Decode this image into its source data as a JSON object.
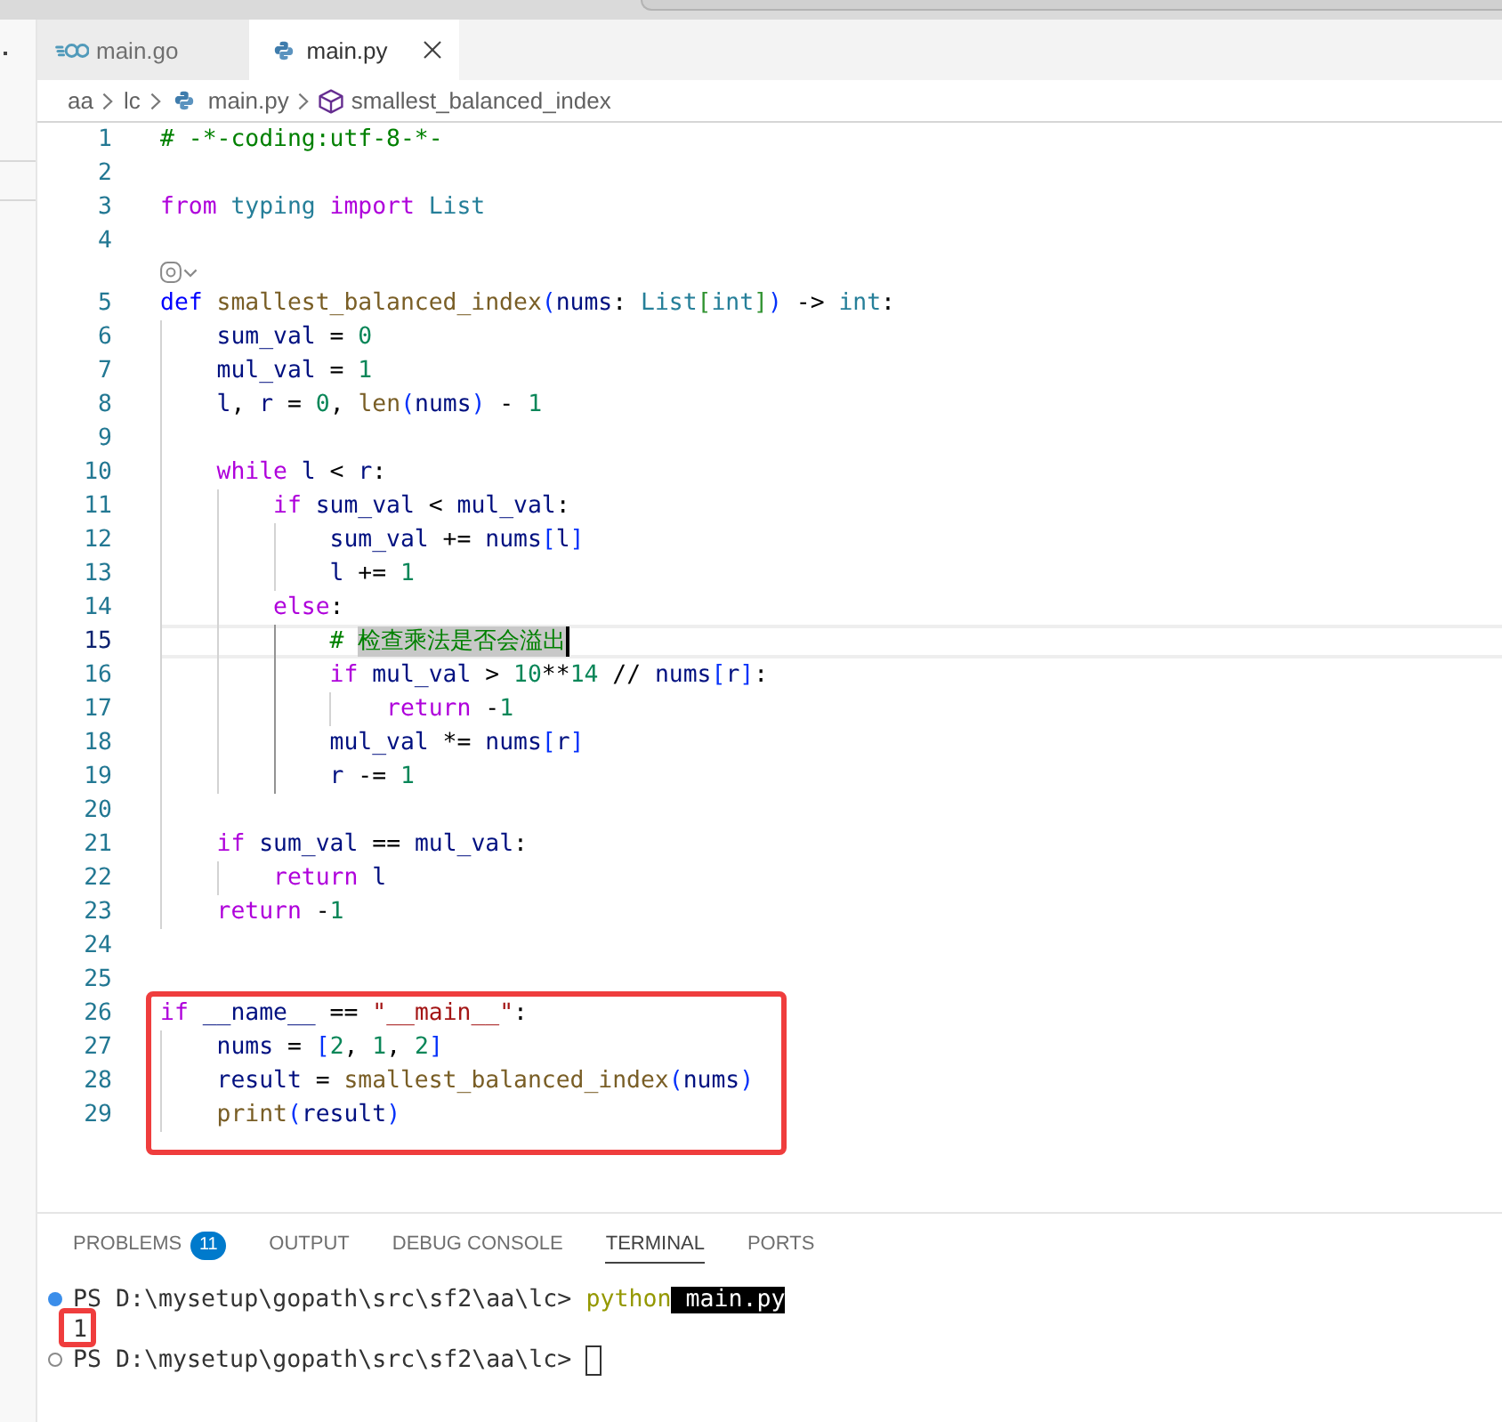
{
  "editor_tabs": [
    {
      "label": "main.go",
      "kind": "go",
      "selected": false
    },
    {
      "label": "main.py",
      "kind": "python",
      "selected": true
    }
  ],
  "breadcrumb": [
    {
      "label": "aa",
      "kind": "folder"
    },
    {
      "label": "lc",
      "kind": "folder"
    },
    {
      "label": "main.py",
      "kind": "python"
    },
    {
      "label": "smallest_balanced_index",
      "kind": "function"
    }
  ],
  "editor": {
    "lines": [
      {
        "kind": "code",
        "number": "1",
        "current": false,
        "boxed": false,
        "tokens": [
          {
            "text": "# -*-coding:utf-8-*-",
            "kind": "comment"
          }
        ]
      },
      {
        "kind": "code",
        "number": "2",
        "current": false,
        "boxed": false
      },
      {
        "kind": "code",
        "number": "3",
        "current": false,
        "boxed": false,
        "tokens": [
          {
            "text": "from",
            "kind": "keyword"
          },
          {
            "text": " typing",
            "kind": "type"
          },
          {
            "text": " import",
            "kind": "keyword"
          },
          {
            "text": " List",
            "kind": "type"
          }
        ]
      },
      {
        "kind": "code",
        "number": "4",
        "current": false,
        "boxed": false
      },
      {
        "kind": "codelens"
      },
      {
        "kind": "code",
        "number": "5",
        "current": false,
        "boxed": false,
        "tokens": [
          {
            "text": "def",
            "kind": "storage"
          },
          {
            "text": " smallest_balanced_index",
            "kind": "function"
          },
          {
            "text": "(",
            "kind": "bracket"
          },
          {
            "text": "nums",
            "kind": "variable"
          },
          {
            "text": ": ",
            "kind": "plain"
          },
          {
            "text": "List",
            "kind": "type"
          },
          {
            "text": "[",
            "kind": "subbracket"
          },
          {
            "text": "int",
            "kind": "type"
          },
          {
            "text": "]",
            "kind": "subbracket"
          },
          {
            "text": ")",
            "kind": "bracket"
          },
          {
            "text": " -> ",
            "kind": "plain"
          },
          {
            "text": "int",
            "kind": "type"
          },
          {
            "text": ":",
            "kind": "plain"
          }
        ]
      },
      {
        "kind": "code",
        "number": "6",
        "current": false,
        "boxed": false,
        "tokens": [
          {
            "text": "    sum_val",
            "kind": "variable"
          },
          {
            "text": " = ",
            "kind": "plain"
          },
          {
            "text": "0",
            "kind": "number"
          }
        ]
      },
      {
        "kind": "code",
        "number": "7",
        "current": false,
        "boxed": false,
        "tokens": [
          {
            "text": "    mul_val",
            "kind": "variable"
          },
          {
            "text": " = ",
            "kind": "plain"
          },
          {
            "text": "1",
            "kind": "number"
          }
        ]
      },
      {
        "kind": "code",
        "number": "8",
        "current": false,
        "boxed": false,
        "tokens": [
          {
            "text": "    l",
            "kind": "variable"
          },
          {
            "text": ", ",
            "kind": "plain"
          },
          {
            "text": "r",
            "kind": "variable"
          },
          {
            "text": " = ",
            "kind": "plain"
          },
          {
            "text": "0",
            "kind": "number"
          },
          {
            "text": ", ",
            "kind": "plain"
          },
          {
            "text": "len",
            "kind": "function"
          },
          {
            "text": "(",
            "kind": "bracket"
          },
          {
            "text": "nums",
            "kind": "variable"
          },
          {
            "text": ")",
            "kind": "bracket"
          },
          {
            "text": " - ",
            "kind": "plain"
          },
          {
            "text": "1",
            "kind": "number"
          }
        ]
      },
      {
        "kind": "code",
        "number": "9",
        "current": false,
        "boxed": false
      },
      {
        "kind": "code",
        "number": "10",
        "current": false,
        "boxed": false,
        "tokens": [
          {
            "text": "    while",
            "kind": "keyword"
          },
          {
            "text": " l",
            "kind": "variable"
          },
          {
            "text": " < ",
            "kind": "plain"
          },
          {
            "text": "r",
            "kind": "variable"
          },
          {
            "text": ":",
            "kind": "plain"
          }
        ]
      },
      {
        "kind": "code",
        "number": "11",
        "current": false,
        "boxed": false,
        "tokens": [
          {
            "text": "        if",
            "kind": "keyword"
          },
          {
            "text": " sum_val",
            "kind": "variable"
          },
          {
            "text": " < ",
            "kind": "plain"
          },
          {
            "text": "mul_val",
            "kind": "variable"
          },
          {
            "text": ":",
            "kind": "plain"
          }
        ]
      },
      {
        "kind": "code",
        "number": "12",
        "current": false,
        "boxed": false,
        "tokens": [
          {
            "text": "            sum_val",
            "kind": "variable"
          },
          {
            "text": " += ",
            "kind": "plain"
          },
          {
            "text": "nums",
            "kind": "variable"
          },
          {
            "text": "[",
            "kind": "bracket"
          },
          {
            "text": "l",
            "kind": "variable"
          },
          {
            "text": "]",
            "kind": "bracket"
          }
        ]
      },
      {
        "kind": "code",
        "number": "13",
        "current": false,
        "boxed": false,
        "tokens": [
          {
            "text": "            l",
            "kind": "variable"
          },
          {
            "text": " += ",
            "kind": "plain"
          },
          {
            "text": "1",
            "kind": "number"
          }
        ]
      },
      {
        "kind": "code",
        "number": "14",
        "current": false,
        "boxed": false,
        "tokens": [
          {
            "text": "        else",
            "kind": "keyword"
          },
          {
            "text": ":",
            "kind": "plain"
          }
        ]
      },
      {
        "kind": "code",
        "number": "15",
        "current": true,
        "boxed": false,
        "tokens": [
          {
            "text": "            # ",
            "kind": "comment",
            "selected": false
          },
          {
            "text": "检查乘法是否会溢出",
            "kind": "comment",
            "selected": true
          }
        ]
      },
      {
        "kind": "code",
        "number": "16",
        "current": false,
        "boxed": false,
        "tokens": [
          {
            "text": "            if",
            "kind": "keyword"
          },
          {
            "text": " mul_val",
            "kind": "variable"
          },
          {
            "text": " > ",
            "kind": "plain"
          },
          {
            "text": "10",
            "kind": "number"
          },
          {
            "text": "**",
            "kind": "plain"
          },
          {
            "text": "14",
            "kind": "number"
          },
          {
            "text": " // ",
            "kind": "plain"
          },
          {
            "text": "nums",
            "kind": "variable"
          },
          {
            "text": "[",
            "kind": "bracket"
          },
          {
            "text": "r",
            "kind": "variable"
          },
          {
            "text": "]",
            "kind": "bracket"
          },
          {
            "text": ":",
            "kind": "plain"
          }
        ]
      },
      {
        "kind": "code",
        "number": "17",
        "current": false,
        "boxed": false,
        "tokens": [
          {
            "text": "                return",
            "kind": "keyword"
          },
          {
            "text": " -",
            "kind": "plain"
          },
          {
            "text": "1",
            "kind": "number"
          }
        ]
      },
      {
        "kind": "code",
        "number": "18",
        "current": false,
        "boxed": false,
        "tokens": [
          {
            "text": "            mul_val",
            "kind": "variable"
          },
          {
            "text": " *= ",
            "kind": "plain"
          },
          {
            "text": "nums",
            "kind": "variable"
          },
          {
            "text": "[",
            "kind": "bracket"
          },
          {
            "text": "r",
            "kind": "variable"
          },
          {
            "text": "]",
            "kind": "bracket"
          }
        ]
      },
      {
        "kind": "code",
        "number": "19",
        "current": false,
        "boxed": false,
        "tokens": [
          {
            "text": "            r",
            "kind": "variable"
          },
          {
            "text": " -= ",
            "kind": "plain"
          },
          {
            "text": "1",
            "kind": "number"
          }
        ]
      },
      {
        "kind": "code",
        "number": "20",
        "current": false,
        "boxed": false
      },
      {
        "kind": "code",
        "number": "21",
        "current": false,
        "boxed": false,
        "tokens": [
          {
            "text": "    if",
            "kind": "keyword"
          },
          {
            "text": " sum_val",
            "kind": "variable"
          },
          {
            "text": " == ",
            "kind": "plain"
          },
          {
            "text": "mul_val",
            "kind": "variable"
          },
          {
            "text": ":",
            "kind": "plain"
          }
        ]
      },
      {
        "kind": "code",
        "number": "22",
        "current": false,
        "boxed": false,
        "tokens": [
          {
            "text": "        return",
            "kind": "keyword"
          },
          {
            "text": " l",
            "kind": "variable"
          }
        ]
      },
      {
        "kind": "code",
        "number": "23",
        "current": false,
        "boxed": false,
        "tokens": [
          {
            "text": "    return",
            "kind": "keyword"
          },
          {
            "text": " -",
            "kind": "plain"
          },
          {
            "text": "1",
            "kind": "number"
          }
        ]
      },
      {
        "kind": "code",
        "number": "24",
        "current": false,
        "boxed": false
      },
      {
        "kind": "code",
        "number": "25",
        "current": false,
        "boxed": false
      },
      {
        "kind": "code",
        "number": "26",
        "current": false,
        "boxed": true,
        "tokens": [
          {
            "text": "if",
            "kind": "keyword"
          },
          {
            "text": " __name__",
            "kind": "variable"
          },
          {
            "text": " == ",
            "kind": "plain"
          },
          {
            "text": "\"__main__\"",
            "kind": "string"
          },
          {
            "text": ":",
            "kind": "plain"
          }
        ]
      },
      {
        "kind": "code",
        "number": "27",
        "current": false,
        "boxed": true,
        "tokens": [
          {
            "text": "    nums",
            "kind": "variable"
          },
          {
            "text": " = ",
            "kind": "plain"
          },
          {
            "text": "[",
            "kind": "bracket"
          },
          {
            "text": "2",
            "kind": "number"
          },
          {
            "text": ", ",
            "kind": "plain"
          },
          {
            "text": "1",
            "kind": "number"
          },
          {
            "text": ", ",
            "kind": "plain"
          },
          {
            "text": "2",
            "kind": "number"
          },
          {
            "text": "]",
            "kind": "bracket"
          }
        ]
      },
      {
        "kind": "code",
        "number": "28",
        "current": false,
        "boxed": true,
        "tokens": [
          {
            "text": "    result",
            "kind": "variable"
          },
          {
            "text": " = ",
            "kind": "plain"
          },
          {
            "text": "smallest_balanced_index",
            "kind": "function"
          },
          {
            "text": "(",
            "kind": "bracket"
          },
          {
            "text": "nums",
            "kind": "variable"
          },
          {
            "text": ")",
            "kind": "bracket"
          }
        ]
      },
      {
        "kind": "code",
        "number": "29",
        "current": false,
        "boxed": true,
        "tokens": [
          {
            "text": "    print",
            "kind": "function"
          },
          {
            "text": "(",
            "kind": "bracket"
          },
          {
            "text": "result",
            "kind": "variable"
          },
          {
            "text": ")",
            "kind": "bracket"
          }
        ]
      }
    ]
  },
  "panel": {
    "tabs": [
      {
        "label": "PROBLEMS",
        "badge": "11",
        "selected": false
      },
      {
        "label": "OUTPUT",
        "selected": false
      },
      {
        "label": "DEBUG CONSOLE",
        "selected": false
      },
      {
        "label": "TERMINAL",
        "selected": true
      },
      {
        "label": "PORTS",
        "selected": false
      }
    ],
    "terminal": {
      "lines": [
        {
          "kind": "command",
          "boxed": false,
          "cursor": false,
          "segments": [
            {
              "text": "PS D:\\mysetup\\gopath\\src\\sf2\\aa\\lc> ",
              "kind": "prompt",
              "selected": false
            },
            {
              "text": "python",
              "kind": "command",
              "selected": false
            },
            {
              "text": " main.py",
              "kind": "argument",
              "selected": true
            }
          ]
        },
        {
          "kind": "output",
          "boxed": true,
          "cursor": false,
          "segments": [
            {
              "text": "1",
              "kind": "output",
              "selected": false
            }
          ]
        },
        {
          "kind": "prompt",
          "boxed": false,
          "cursor": true,
          "segments": [
            {
              "text": "PS D:\\mysetup\\gopath\\src\\sf2\\aa\\lc> ",
              "kind": "prompt",
              "selected": false
            }
          ]
        }
      ]
    }
  }
}
